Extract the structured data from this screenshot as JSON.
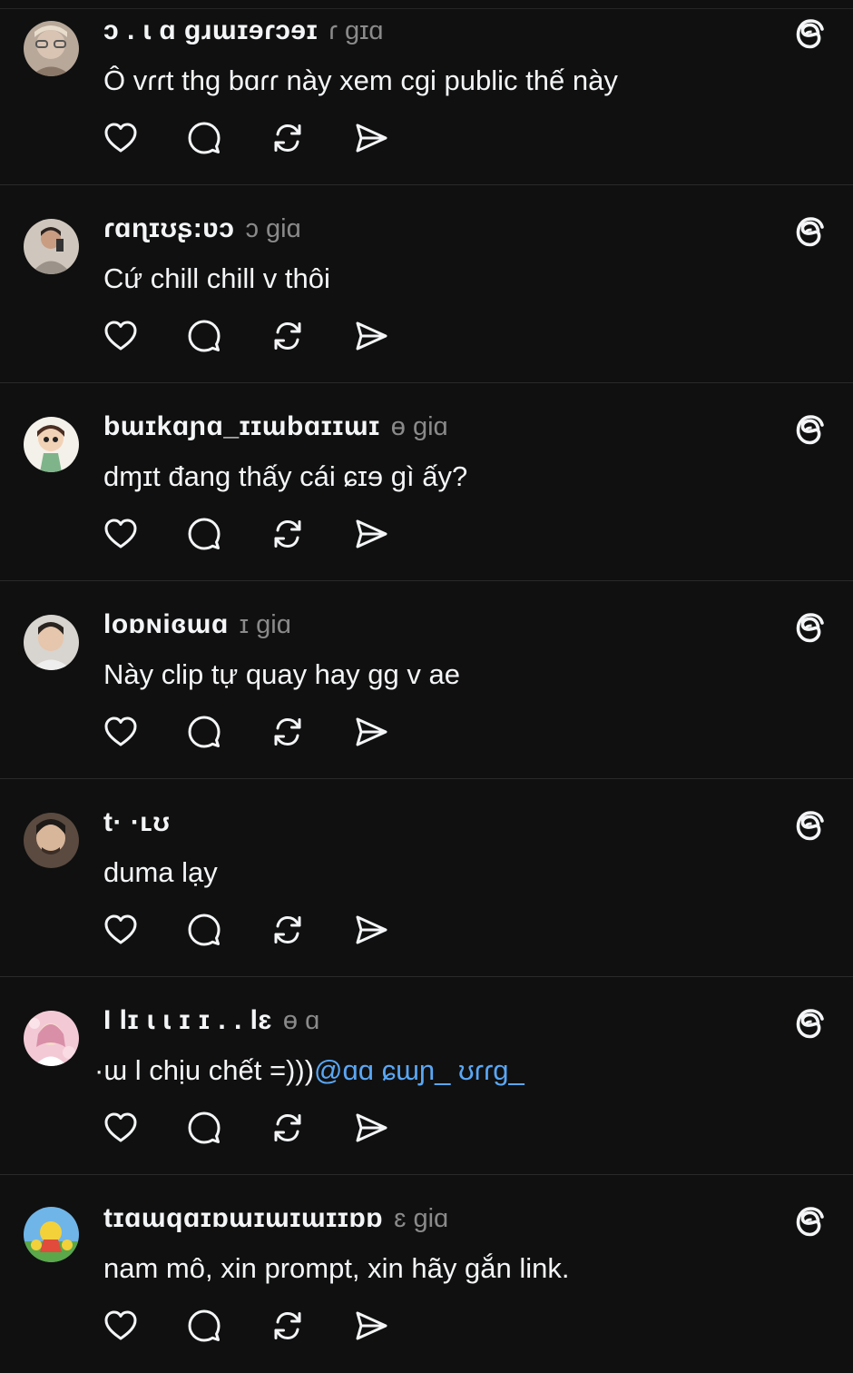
{
  "colors": {
    "background": "#101010",
    "text": "#f3f5f7",
    "muted": "#8a8a8a",
    "mention": "#5aa7f4",
    "divider": "#2a2a2a"
  },
  "actions": {
    "icons": [
      "heart-icon",
      "comment-icon",
      "repost-icon",
      "share-icon"
    ]
  },
  "posts": [
    {
      "username": "ɔ . ɩ ɑ ɡɹɯɪɘɾɔɘɪ",
      "time": "ɾ ɡɪɑ",
      "text": "Ô vɾɾt thg bɑɾɾ này xem cgi public thế này",
      "mention": "",
      "avatar_icon": "avatar-image"
    },
    {
      "username": "ɾɑɳɪʊʂ:ʋɔ",
      "time": "ɔ giɑ",
      "text": "Cứ chill chill v thôi",
      "mention": "",
      "avatar_icon": "avatar-image"
    },
    {
      "username": "bɯɪkɑɲɑ_ɪɪɯbɑɪɪɯɪ",
      "time": "ɵ giɑ",
      "text": "dɱɪt đang thấy cái ɕɪɘ gì ấy?",
      "mention": "",
      "avatar_icon": "avatar-image"
    },
    {
      "username": "loɒɴiɞɯɑ",
      "time": "ɪ giɑ",
      "text": "Này clip tự quay hay gg v ae",
      "mention": "",
      "avatar_icon": "avatar-image"
    },
    {
      "username": "t·  ·ʟʊ",
      "time": "",
      "text": "duma lạy",
      "mention": "",
      "avatar_icon": "avatar-image"
    },
    {
      "username": "I lɪ  ɩ ɩ ɪ ɪ   . . lɛ",
      "time": "ɵ ɑ",
      "text": "·ɯ l chịu chết =)))",
      "mention": "@ɑɑ ɕɯɲ_   ʊɾɾɡ_",
      "avatar_icon": "avatar-image"
    },
    {
      "username": "tɪɑɯqɑɪɒɯɪɯɪɯɪɪɒɒ",
      "time": "ɛ giɑ",
      "text": "nam mô, xin prompt, xin hãy gắn link.",
      "mention": "",
      "avatar_icon": "avatar-image"
    }
  ]
}
